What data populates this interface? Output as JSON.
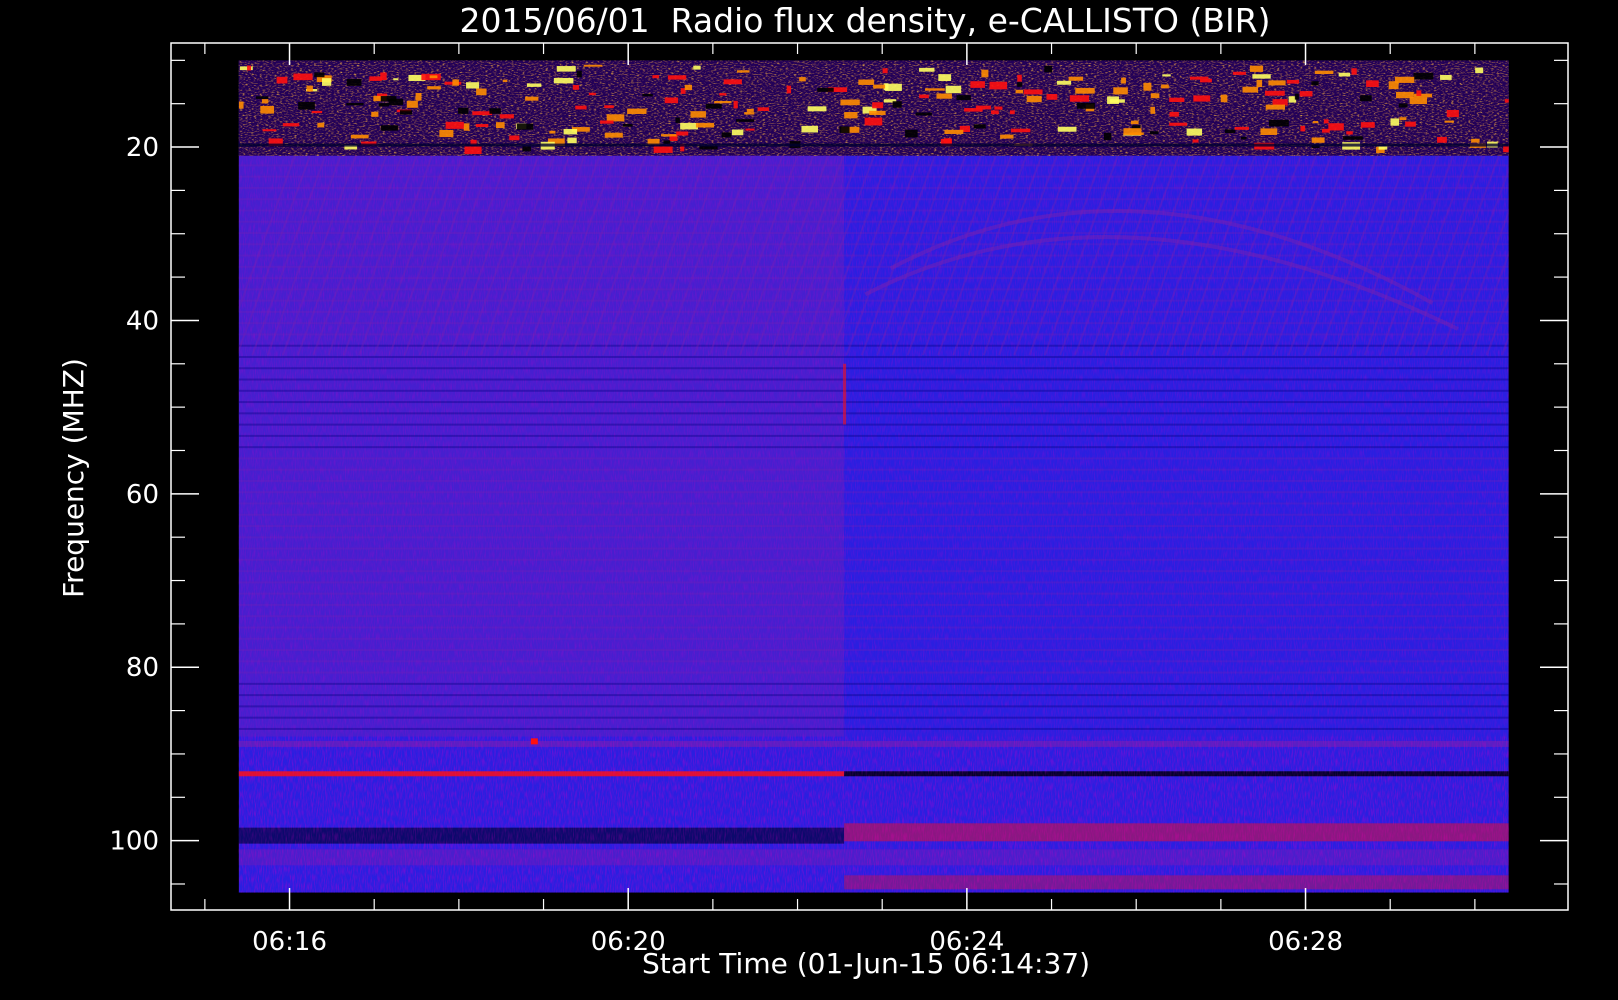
{
  "chart_data": {
    "type": "heatmap",
    "title": "2015/06/01  Radio flux density, e-CALLISTO (BIR)",
    "xlabel": "Start Time (01-Jun-15 06:14:37)",
    "ylabel": "Frequency (MHZ)",
    "x_ticks": [
      "06:16",
      "06:20",
      "06:24",
      "06:28"
    ],
    "y_ticks": [
      "20",
      "40",
      "60",
      "80",
      "100"
    ],
    "xlim_minutes": [
      14.6,
      31.1
    ],
    "ylim_mhz": [
      108,
      8
    ],
    "data_extent": {
      "time_start_min": 15.4,
      "time_end_min": 30.4,
      "freq_top_mhz": 10,
      "freq_bottom_mhz": 106
    },
    "colormap": [
      "#000000",
      "#0000ff",
      "#7a1fb0",
      "#ff1010",
      "#ff8c00",
      "#ffff60"
    ],
    "background_color": "#2a1fe0",
    "axis_color": "#ffffff"
  }
}
